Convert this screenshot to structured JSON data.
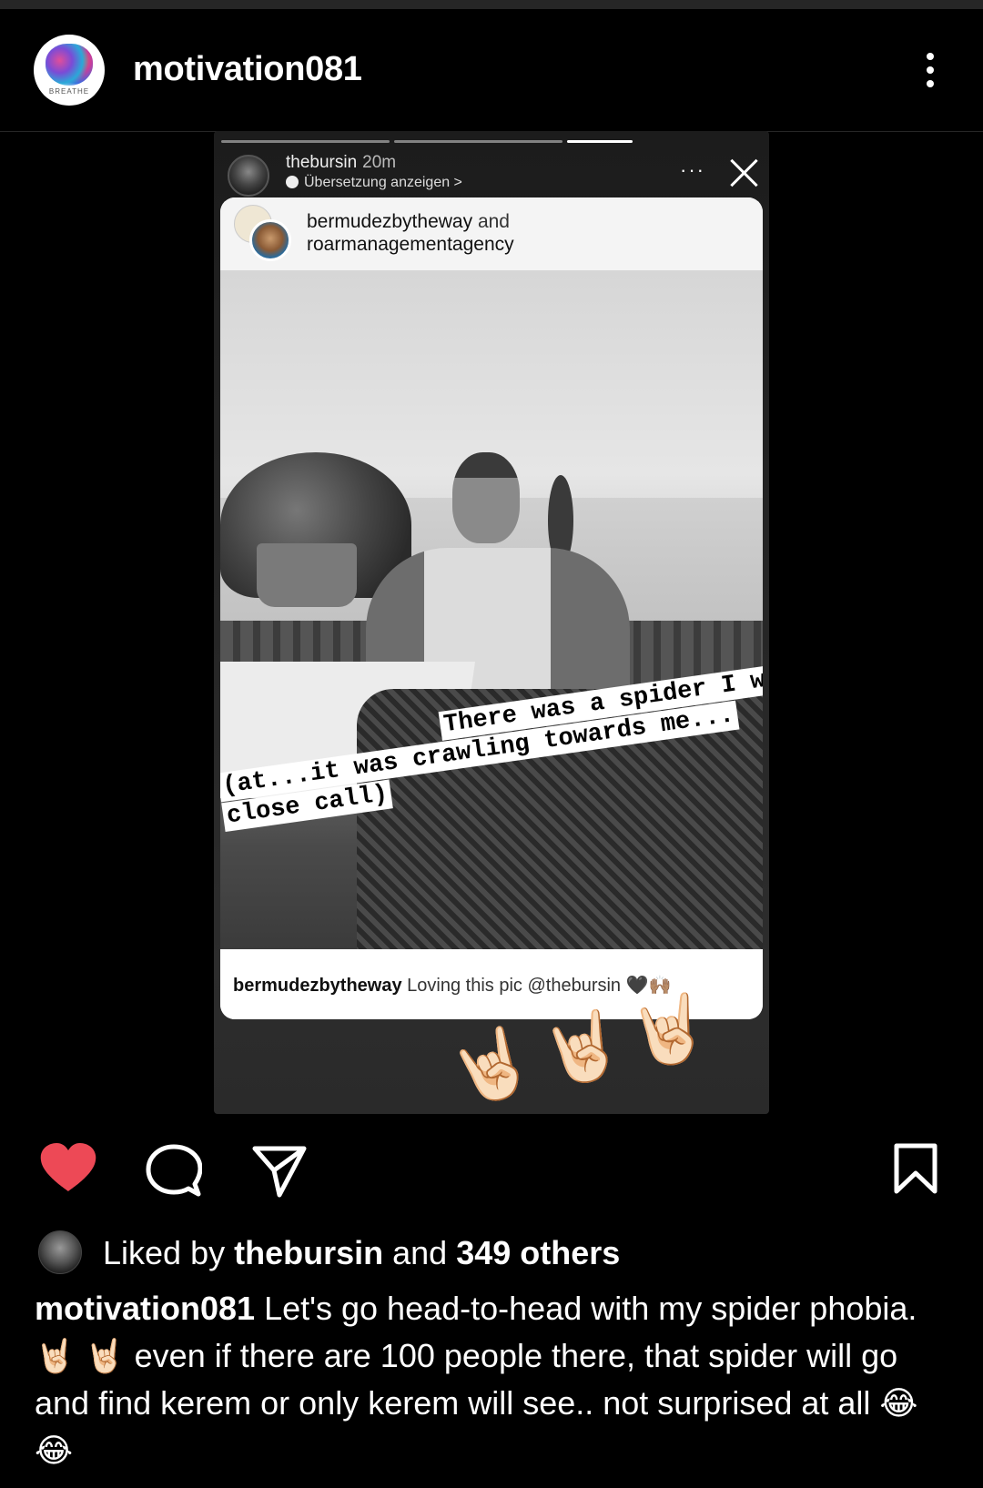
{
  "header": {
    "username": "motivation081",
    "avatar_text": "BREATHE",
    "more_icon": "more-vertical-icon"
  },
  "story": {
    "username": "thebursin",
    "time": "20m",
    "translate_label": "Übersetzung anzeigen >",
    "more_icon": "more-horizontal-icon",
    "close_icon": "close-icon",
    "shared_post": {
      "author1": "bermudezbytheway",
      "and": "and",
      "author2": "roarmanagementagency",
      "caption_lines": [
        "There was a spider I was lookin",
        "at...it was crawling towards me...",
        "close call)"
      ],
      "caption_prefix": "(",
      "comment_user": "bermudezbytheway",
      "comment_text": "Loving this pic @thebursin 🖤🙌🏽"
    },
    "stickers": [
      "🤘🏻",
      "🤘🏻",
      "🤘🏻"
    ]
  },
  "actions": {
    "like_icon": "heart-icon",
    "liked": true,
    "like_color": "#ed4956",
    "comment_icon": "comment-icon",
    "share_icon": "share-icon",
    "save_icon": "bookmark-icon"
  },
  "likes": {
    "prefix": "Liked by",
    "user": "thebursin",
    "middle": "and",
    "others": "349 others"
  },
  "caption": {
    "username": "motivation081",
    "text": "Let's go head-to-head with my spider phobia. 🤘🏻 🤘🏻 even if there are 100 people there, that spider will go and find kerem or only kerem will see.. not surprised at all 😂😂"
  }
}
